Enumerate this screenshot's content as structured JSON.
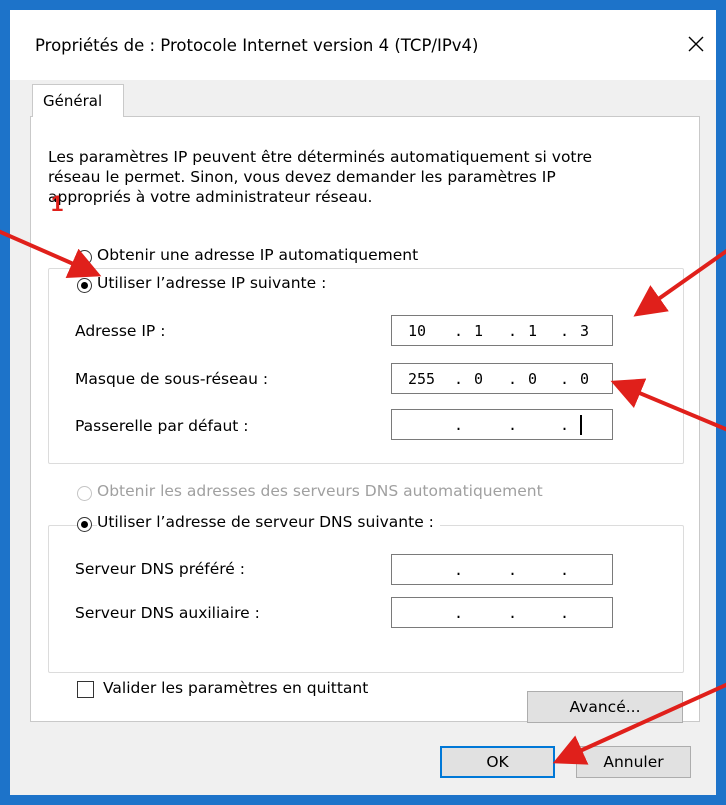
{
  "window": {
    "title": "Propriétés de : Protocole Internet version 4 (TCP/IPv4)",
    "close_icon": "close-icon",
    "frame_color": "#1d73c9"
  },
  "tab": {
    "label": "Général"
  },
  "description": [
    "Les paramètres IP peuvent être déterminés automatiquement si votre",
    "réseau le permet. Sinon, vous devez demander les paramètres IP",
    "appropriés à votre administrateur réseau."
  ],
  "ip_section": {
    "auto_label": "Obtenir une adresse IP automatiquement",
    "manual_label": "Utiliser l’adresse IP suivante :",
    "selected": "manual",
    "fields": [
      {
        "label": "Adresse IP :",
        "octets": [
          "10",
          "1",
          "1",
          "3"
        ]
      },
      {
        "label": "Masque de sous-réseau :",
        "octets": [
          "255",
          "0",
          "0",
          "0"
        ]
      },
      {
        "label": "Passerelle par défaut :",
        "octets": [
          "",
          "",
          "",
          ""
        ]
      }
    ]
  },
  "dns_section": {
    "auto_label": "Obtenir les adresses des serveurs DNS automatiquement",
    "manual_label": "Utiliser l’adresse de serveur DNS suivante :",
    "selected": "manual",
    "fields": [
      {
        "label": "Serveur DNS préféré :",
        "octets": [
          "",
          "",
          "",
          ""
        ]
      },
      {
        "label": "Serveur DNS auxiliaire :",
        "octets": [
          "",
          "",
          "",
          ""
        ]
      }
    ]
  },
  "validate_checkbox": {
    "label": "Valider les paramètres en quittant",
    "checked": false
  },
  "buttons": {
    "advanced": "Avancé...",
    "ok": "OK",
    "cancel": "Annuler"
  },
  "annotation": {
    "number": "1",
    "color": "#e0201b"
  }
}
